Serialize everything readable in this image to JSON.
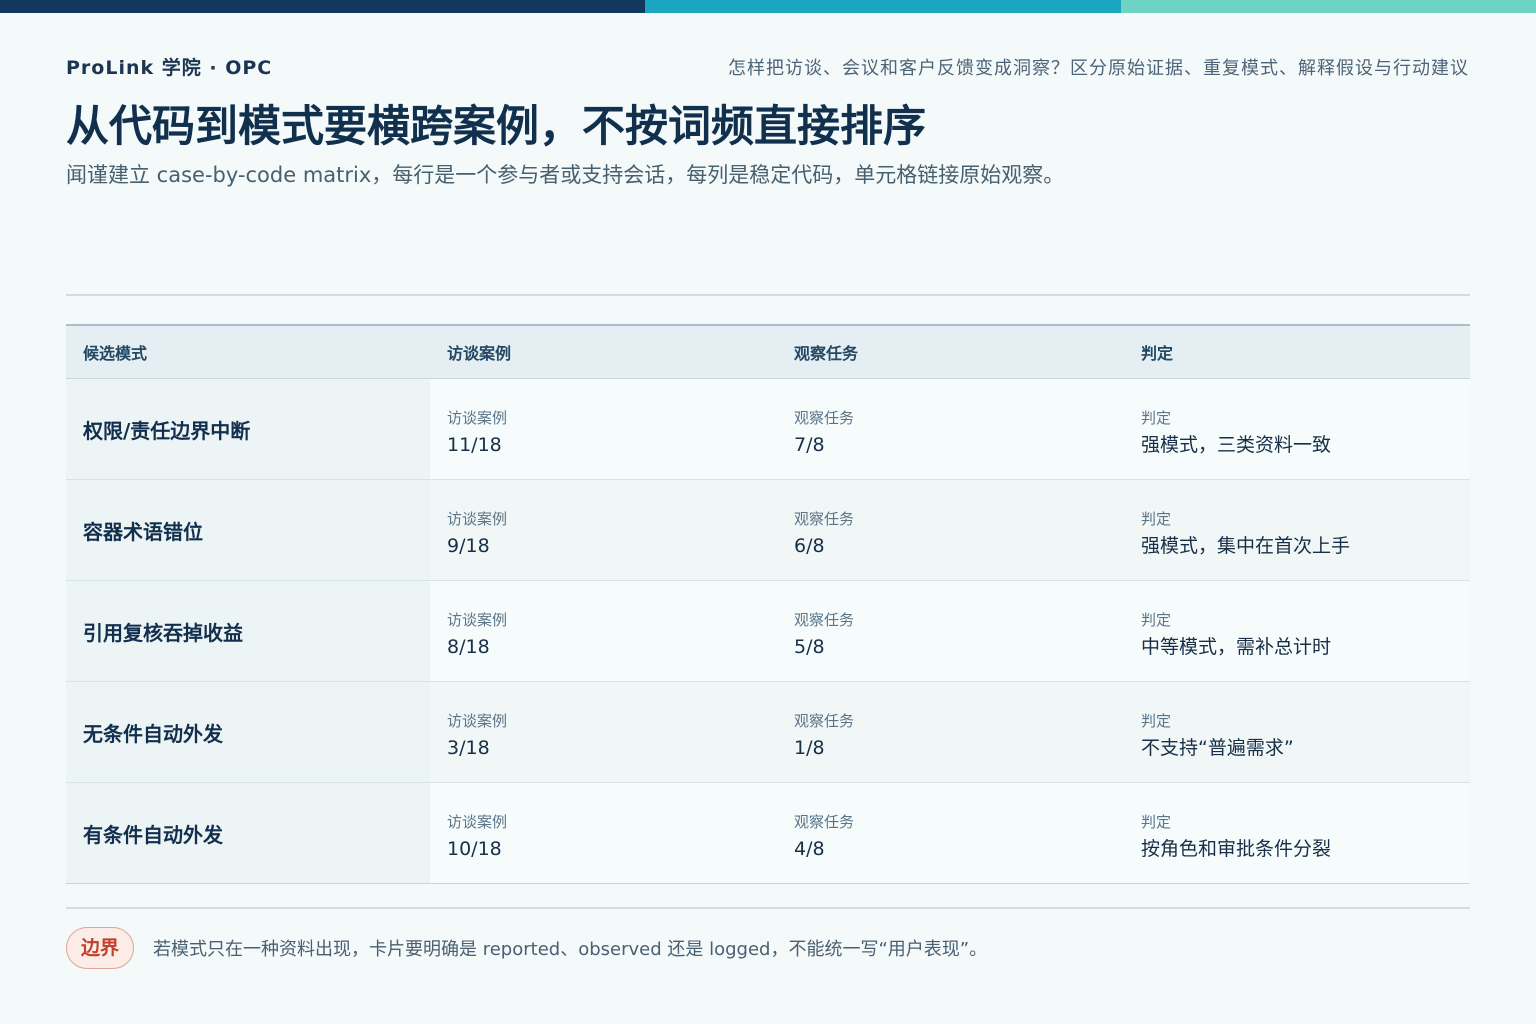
{
  "brand": "ProLink 学院 · OPC",
  "question": "怎样把访谈、会议和客户反馈变成洞察？区分原始证据、重复模式、解释假设与行动建议",
  "title": "从代码到模式要横跨案例，不按词频直接排序",
  "subtitle": "闻谨建立 case-by-code matrix，每行是一个参与者或支持会话，每列是稳定代码，单元格链接原始观察。",
  "table": {
    "headers": [
      "候选模式",
      "访谈案例",
      "观察任务",
      "判定"
    ],
    "cell_labels": [
      "访谈案例",
      "观察任务",
      "判定"
    ],
    "rows": [
      {
        "pattern": "权限/责任边界中断",
        "interviews": "11/18",
        "observations": "7/8",
        "verdict": "强模式，三类资料一致"
      },
      {
        "pattern": "容器术语错位",
        "interviews": "9/18",
        "observations": "6/8",
        "verdict": "强模式，集中在首次上手"
      },
      {
        "pattern": "引用复核吞掉收益",
        "interviews": "8/18",
        "observations": "5/8",
        "verdict": "中等模式，需补总计时"
      },
      {
        "pattern": "无条件自动外发",
        "interviews": "3/18",
        "observations": "1/8",
        "verdict": "不支持“普遍需求”"
      },
      {
        "pattern": "有条件自动外发",
        "interviews": "10/18",
        "observations": "4/8",
        "verdict": "按角色和审批条件分裂"
      }
    ]
  },
  "footer": {
    "badge": "边界",
    "note": "若模式只在一种资料出现，卡片要明确是 reported、observed 还是 logged，不能统一写“用户表现”。"
  }
}
